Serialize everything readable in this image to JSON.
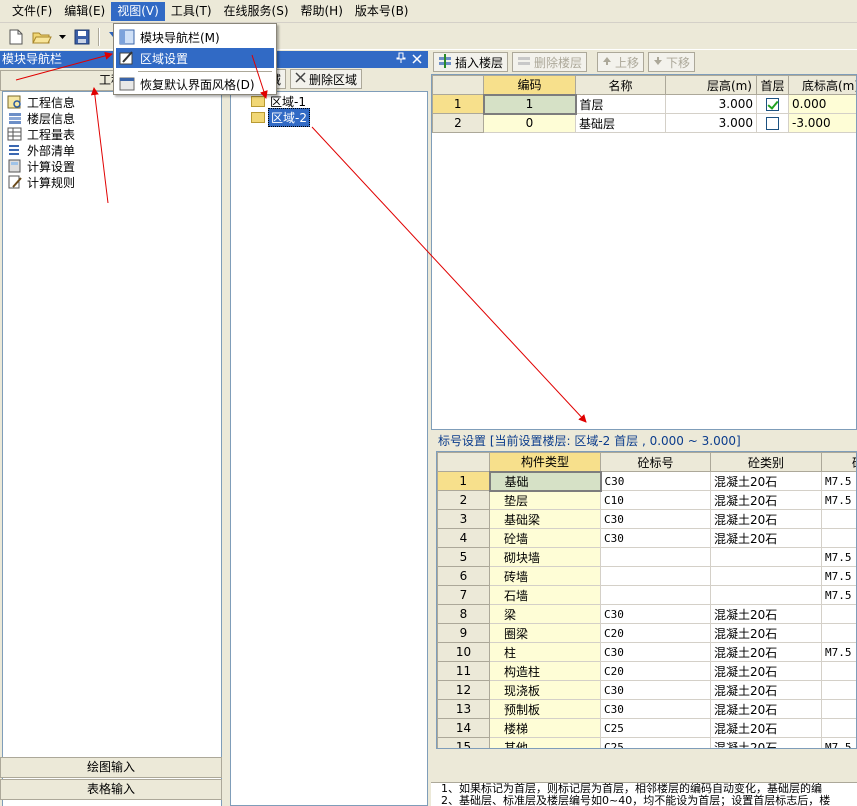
{
  "menubar": {
    "items": [
      "文件(F)",
      "编辑(E)",
      "视图(V)",
      "工具(T)",
      "在线服务(S)",
      "帮助(H)",
      "版本号(B)"
    ],
    "active_index": 2
  },
  "toolbar": {
    "icons": [
      "new-file-icon",
      "open-folder-icon",
      "save-icon",
      "undo-icon"
    ]
  },
  "view_menu": {
    "items": [
      "模块导航栏(M)",
      "区域设置",
      "恢复默认界面风格(D)"
    ],
    "highlighted_index": 1
  },
  "nav": {
    "header": "模块导航栏",
    "tab_label": "工程",
    "items": [
      {
        "label": "工程信息",
        "icon": "project-info-icon"
      },
      {
        "label": "楼层信息",
        "icon": "floor-info-icon"
      },
      {
        "label": "工程量表",
        "icon": "quantity-table-icon"
      },
      {
        "label": "外部清单",
        "icon": "external-list-icon"
      },
      {
        "label": "计算设置",
        "icon": "calc-settings-icon"
      },
      {
        "label": "计算规则",
        "icon": "calc-rules-icon"
      }
    ],
    "bottom_buttons": [
      "绘图输入",
      "表格输入"
    ]
  },
  "region": {
    "header_pin": "pin-icon",
    "header_close": "close-icon",
    "add_label": "区域",
    "delete_label": "删除区域",
    "tree": [
      "区域-1",
      "区域-2"
    ],
    "selected_index": 1
  },
  "floor_toolbar": {
    "insert_label": "插入楼层",
    "delete_label": "删除楼层",
    "up_label": "上移",
    "down_label": "下移"
  },
  "floor_table": {
    "headers": [
      "编码",
      "名称",
      "层高(m)",
      "首层",
      "底标高(m)"
    ],
    "rows": [
      {
        "rn": "1",
        "code": "1",
        "name": "首层",
        "height": "3.000",
        "first": true,
        "base": "0.000"
      },
      {
        "rn": "2",
        "code": "0",
        "name": "基础层",
        "height": "3.000",
        "first": false,
        "base": "-3.000"
      }
    ]
  },
  "mark_settings": {
    "title": "标号设置 [当前设置楼层: 区域-2 首层 , 0.000 ~ 3.000]",
    "headers": [
      "构件类型",
      "砼标号",
      "砼类别",
      "砂"
    ],
    "rows": [
      {
        "rn": "1",
        "type": "基础",
        "grade": "C30",
        "cat": "混凝土20石",
        "mortar": "M7.5"
      },
      {
        "rn": "2",
        "type": "垫层",
        "grade": "C10",
        "cat": "混凝土20石",
        "mortar": "M7.5"
      },
      {
        "rn": "3",
        "type": "基础梁",
        "grade": "C30",
        "cat": "混凝土20石",
        "mortar": ""
      },
      {
        "rn": "4",
        "type": "砼墙",
        "grade": "C30",
        "cat": "混凝土20石",
        "mortar": ""
      },
      {
        "rn": "5",
        "type": "砌块墙",
        "grade": "",
        "cat": "",
        "mortar": "M7.5"
      },
      {
        "rn": "6",
        "type": "砖墙",
        "grade": "",
        "cat": "",
        "mortar": "M7.5"
      },
      {
        "rn": "7",
        "type": "石墙",
        "grade": "",
        "cat": "",
        "mortar": "M7.5"
      },
      {
        "rn": "8",
        "type": "梁",
        "grade": "C30",
        "cat": "混凝土20石",
        "mortar": ""
      },
      {
        "rn": "9",
        "type": "圈梁",
        "grade": "C20",
        "cat": "混凝土20石",
        "mortar": ""
      },
      {
        "rn": "10",
        "type": "柱",
        "grade": "C30",
        "cat": "混凝土20石",
        "mortar": "M7.5"
      },
      {
        "rn": "11",
        "type": "构造柱",
        "grade": "C20",
        "cat": "混凝土20石",
        "mortar": ""
      },
      {
        "rn": "12",
        "type": "现浇板",
        "grade": "C30",
        "cat": "混凝土20石",
        "mortar": ""
      },
      {
        "rn": "13",
        "type": "预制板",
        "grade": "C30",
        "cat": "混凝土20石",
        "mortar": ""
      },
      {
        "rn": "14",
        "type": "楼梯",
        "grade": "C25",
        "cat": "混凝土20石",
        "mortar": ""
      },
      {
        "rn": "15",
        "type": "其他",
        "grade": "C25",
        "cat": "混凝土20石",
        "mortar": "M7.5"
      }
    ]
  },
  "notes": [
    "1、如果标记为首层，则标记层为首层，相邻楼层的编码自动变化，基础层的编",
    "2、基础层、标准层及楼层编号如0~40，均不能设为首层；设置首层标志后，楼"
  ],
  "colors": {
    "title_blue": "#316ac5",
    "header_hot": "#f7e08c",
    "cell_yellow": "#fefdd6",
    "arrow_red": "#e00000"
  }
}
